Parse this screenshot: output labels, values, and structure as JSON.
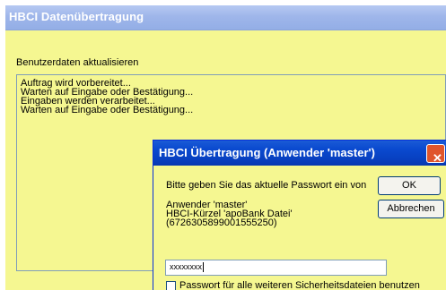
{
  "main_window": {
    "title": "HBCI Datenübertragung",
    "subtitle": "Benutzerdaten aktualisieren",
    "status_lines": [
      "Auftrag wird vorbereitet...",
      "Warten auf Eingabe oder Bestätigung...",
      "Eingaben werden verarbeitet...",
      "Warten auf Eingabe oder Bestätigung..."
    ]
  },
  "dialog": {
    "title": "HBCI Übertragung (Anwender 'master')",
    "close_glyph": "✕",
    "prompt": "Bitte geben Sie das aktuelle Passwort ein von",
    "user_line": "Anwender 'master'",
    "hbci_line": "HBCI-Kürzel 'apoBank Datei'",
    "id_line": "(6726305899001555250)",
    "password_value": "xxxxxxxx",
    "checkbox_label": "Passwort für alle weiteren Sicherheitsdateien benutzen",
    "checkbox_checked": false,
    "ok_label": "OK",
    "cancel_label": "Abbrechen"
  },
  "colors": {
    "window_bg": "#f5f791",
    "dialog_title": "#0a49cf",
    "inactive_title": "#9fb6ea"
  }
}
